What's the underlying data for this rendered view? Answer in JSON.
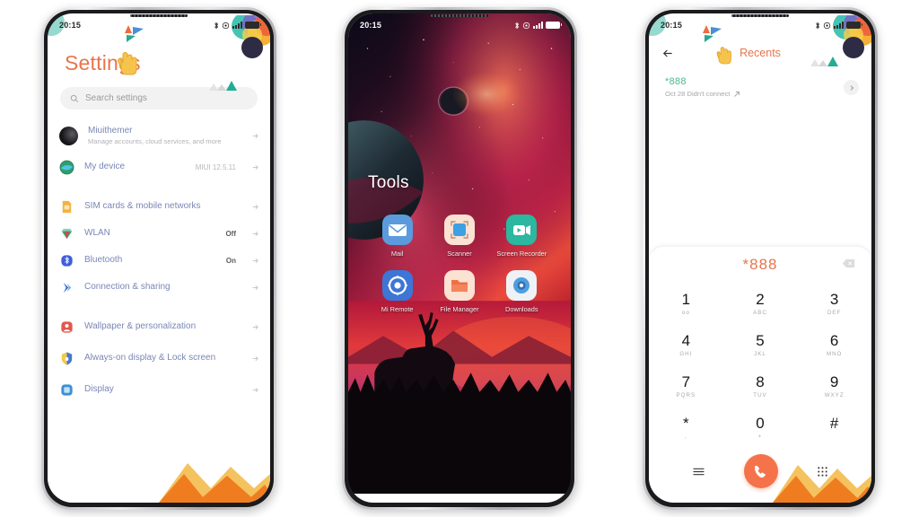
{
  "scene": {
    "background": "#ffffff",
    "device_count": 3,
    "theme_accent": "#e8744b"
  },
  "phone1": {
    "name": "settings-screen",
    "statusbar": {
      "time": "20:15",
      "icons": [
        "bluetooth-icon",
        "alarm-icon",
        "signal-icon",
        "battery-icon"
      ]
    },
    "title": "Settings",
    "search": {
      "placeholder": "Search settings",
      "icon": "search-icon"
    },
    "items": [
      {
        "label": "Miuithemer",
        "sub": "Manage accounts, cloud services, and more",
        "value": "",
        "icon": "account-avatar"
      },
      {
        "label": "My device",
        "sub": "",
        "value": "MIUI 12.5.11",
        "icon": "device-icon"
      },
      {
        "label": "SIM cards & mobile networks",
        "sub": "",
        "value": "",
        "icon": "sim-card-icon"
      },
      {
        "label": "WLAN",
        "sub": "",
        "value": "Off",
        "icon": "wlan-icon"
      },
      {
        "label": "Bluetooth",
        "sub": "",
        "value": "On",
        "icon": "bluetooth-icon"
      },
      {
        "label": "Connection & sharing",
        "sub": "",
        "value": "",
        "icon": "connection-icon"
      },
      {
        "label": "Wallpaper & personalization",
        "sub": "",
        "value": "",
        "icon": "wallpaper-icon"
      },
      {
        "label": "Always-on display & Lock screen",
        "sub": "",
        "value": "",
        "icon": "lock-shield-icon"
      },
      {
        "label": "Display",
        "sub": "",
        "value": "",
        "icon": "display-icon"
      }
    ]
  },
  "phone2": {
    "name": "app-folder-screen",
    "statusbar": {
      "time": "20:15",
      "icons": [
        "bluetooth-icon",
        "alarm-icon",
        "signal-icon",
        "battery-icon"
      ]
    },
    "folder_title": "Tools",
    "wallpaper": "space-nebula-deer-silhouette",
    "apps": [
      {
        "label": "Mail",
        "icon": "mail-icon",
        "color": "#5b9bdd"
      },
      {
        "label": "Scanner",
        "icon": "scanner-icon",
        "color": "#fbe2d2"
      },
      {
        "label": "Screen Recorder",
        "icon": "screen-recorder-icon",
        "color": "#2bb7a0"
      },
      {
        "label": "Mi Remote",
        "icon": "remote-icon",
        "color": "#3d76d6"
      },
      {
        "label": "File Manager",
        "icon": "file-manager-icon",
        "color": "#fbe2d2"
      },
      {
        "label": "Downloads",
        "icon": "downloads-icon",
        "color": "#eef2f6"
      }
    ]
  },
  "phone3": {
    "name": "dialer-screen",
    "statusbar": {
      "time": "20:15",
      "icons": [
        "bluetooth-icon",
        "alarm-icon",
        "signal-icon",
        "battery-icon"
      ]
    },
    "header": {
      "title": "Recents",
      "back_icon": "back-arrow-icon"
    },
    "call_log": [
      {
        "number": "*888",
        "detail": "Oct 28 Didn't connect",
        "outgoing_icon": "outgoing-call-icon",
        "chevron": "chevron-right-icon"
      }
    ],
    "dialer": {
      "entered_number": "*888",
      "delete_icon": "backspace-icon",
      "keys": [
        {
          "digit": "1",
          "letters": "oo"
        },
        {
          "digit": "2",
          "letters": "ABC"
        },
        {
          "digit": "3",
          "letters": "DEF"
        },
        {
          "digit": "4",
          "letters": "GHI"
        },
        {
          "digit": "5",
          "letters": "JKL"
        },
        {
          "digit": "6",
          "letters": "MNO"
        },
        {
          "digit": "7",
          "letters": "PQRS"
        },
        {
          "digit": "8",
          "letters": "TUV"
        },
        {
          "digit": "9",
          "letters": "WXYZ"
        },
        {
          "digit": "*",
          "letters": ","
        },
        {
          "digit": "0",
          "letters": "+"
        },
        {
          "digit": "#",
          "letters": ""
        }
      ],
      "actions": {
        "menu_icon": "menu-icon",
        "call_icon": "call-icon",
        "keypad_icon": "keypad-icon",
        "call_button_color": "#f4734a"
      }
    }
  }
}
